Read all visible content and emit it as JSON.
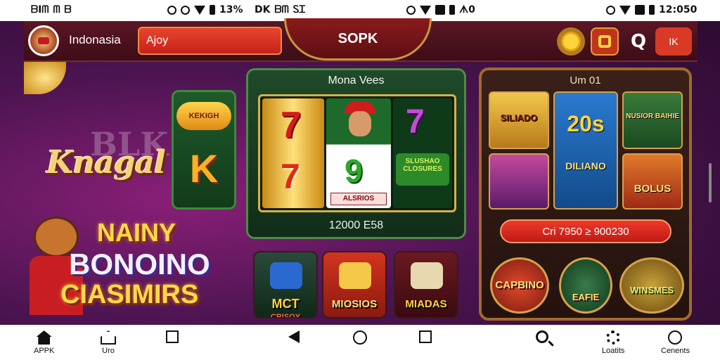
{
  "status_bar": {
    "group1": [
      "ᗷIᗰ",
      "ᗰ",
      "ᗷ"
    ],
    "group2_text": "13%",
    "group3": [
      "DK",
      "ᗷᗰ",
      "ᏚᏆ"
    ],
    "group4_text": "ᗑ0",
    "time": "12:050"
  },
  "header": {
    "region": "Indonasia",
    "search_value": "Ajoy",
    "title": "SOPK",
    "lang_label": "IK",
    "accent": "#d93a26"
  },
  "promo": {
    "bg_word": "BLK",
    "brand": "Knagal",
    "line1": "NAINY",
    "line2": "BONOINO",
    "line3": "CIASIMIRS"
  },
  "mini_tile": {
    "badge": "KEKIGH",
    "letter": "K"
  },
  "slot": {
    "title": "Mona Vees",
    "reel1_top": "7",
    "reel1_bottom": "7",
    "reel2_symbol": "9",
    "reel2_label": "ALSRIOS",
    "reel3_top": "7",
    "reel3_label": "SLUSHAO CLOSURES",
    "jackpot": "12000 E58"
  },
  "games": [
    {
      "label": "MCT",
      "sub": "CRISOY"
    },
    {
      "label": "MIOSIOS"
    },
    {
      "label": "MIADAS"
    }
  ],
  "right_panel": {
    "title": "Um 01",
    "tiles": [
      {
        "label": "SILIADO"
      },
      {
        "label": "20s",
        "sub": "DILIANO"
      },
      {
        "label": "NUSIOR BAIHIE"
      },
      {
        "label": ""
      },
      {
        "label": "BOLUS"
      }
    ],
    "button": "Cri 7950 ≥ 900230",
    "badges": [
      {
        "label": "CAPBINO"
      },
      {
        "label": "EAFIE"
      },
      {
        "label": "WINSMES"
      }
    ]
  },
  "nav": {
    "items": [
      {
        "label": "APPK",
        "icon": "home-icon"
      },
      {
        "label": "Uro",
        "icon": "house-outline-icon"
      },
      {
        "label": "",
        "icon": "square-icon"
      },
      {
        "label": "",
        "icon": "back-icon"
      },
      {
        "label": "",
        "icon": "circle-home-icon"
      },
      {
        "label": "",
        "icon": "recents-icon"
      },
      {
        "label": "",
        "icon": "search-icon"
      },
      {
        "label": "Loatits",
        "icon": "gear-icon"
      },
      {
        "label": "Cenents",
        "icon": "user-icon"
      }
    ]
  }
}
